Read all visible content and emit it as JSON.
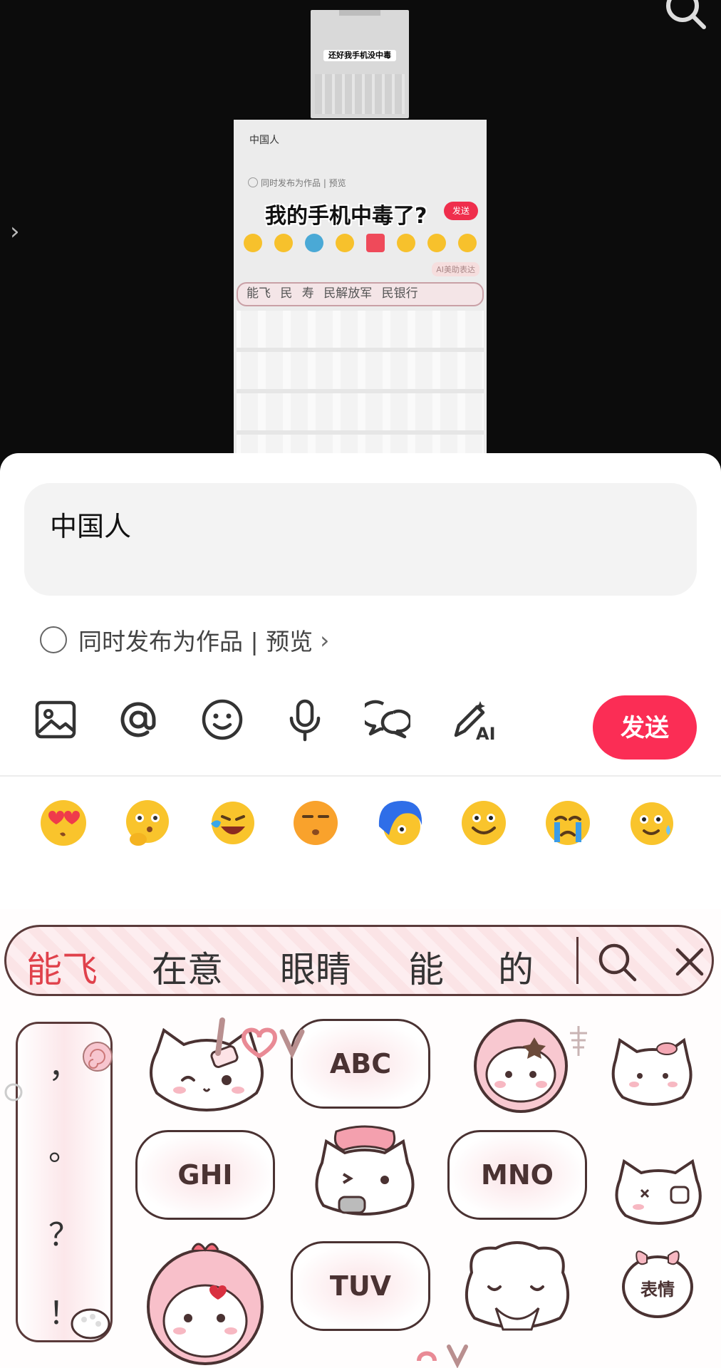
{
  "video": {
    "thumb_small_caption": "还好我手机没中毒",
    "thumb_input": "中国人",
    "thumb_publish": "同时发布为作品 | 预览",
    "thumb_caption": "我的手机中毒了?",
    "thumb_send": "发送",
    "thumb_ai": "AI美助表达",
    "thumb_candidates": "能飞 民 寿 民解放军 民银行"
  },
  "comment": {
    "input_value": "中国人",
    "publish_label": "同时发布为作品 | 预览",
    "publish_chevron": "›",
    "send_label": "发送"
  },
  "toolbar_icons": [
    "image-icon",
    "at-icon",
    "emoji-icon",
    "microphone-icon",
    "chat-bubbles-icon",
    "ai-write-icon"
  ],
  "emoji_row": [
    "heart-eyes-kiss",
    "thinking",
    "laughing-crying",
    "smirk",
    "blue-hair-face",
    "smiling",
    "crying",
    "sweat-smile"
  ],
  "keyboard": {
    "candidates": [
      "能飞",
      "在意",
      "眼睛",
      "能",
      "的"
    ],
    "punctuation": [
      "，",
      "。",
      "？",
      "！"
    ],
    "keys": [
      "ABC",
      "GHI",
      "MNO",
      "TUV"
    ],
    "emoji_key_label": "表情"
  },
  "colors": {
    "accent": "#fb2d55",
    "candidate_highlight": "#e0414b",
    "keyboard_outline": "#4a3232"
  }
}
